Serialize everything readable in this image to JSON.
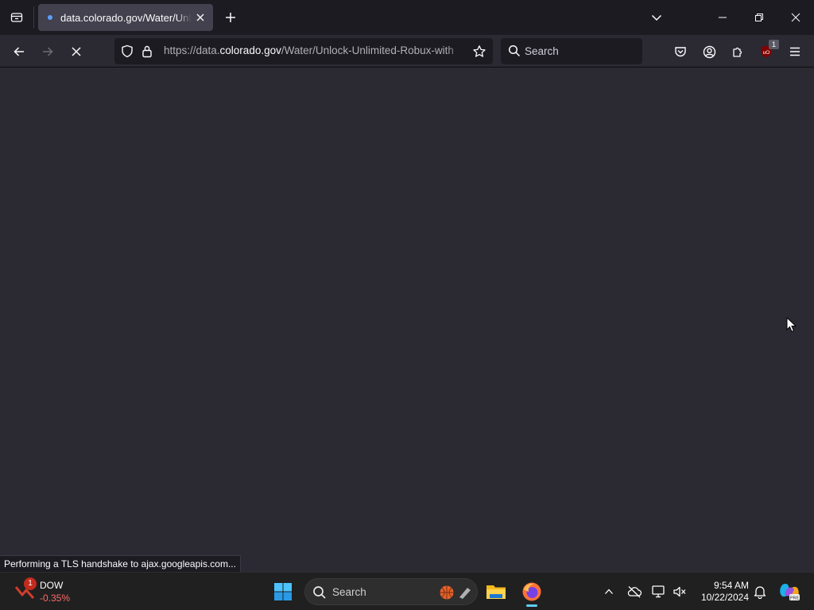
{
  "browser": {
    "tab": {
      "title": "data.colorado.gov/Water/Unlock-Unlimited-Robux-with"
    },
    "url": {
      "prefix": "https://data.",
      "host": "colorado.gov",
      "path": "/Water/Unlock-Unlimited-Robux-with"
    },
    "search": {
      "placeholder": "Search"
    },
    "extension_badge": "1",
    "status": "Performing a TLS handshake to ajax.googleapis.com..."
  },
  "taskbar": {
    "widget": {
      "name": "DOW",
      "change": "-0.35%",
      "badge": "1"
    },
    "search": {
      "placeholder": "Search"
    },
    "clock": {
      "time": "9:54 AM",
      "date": "10/22/2024"
    }
  },
  "colors": {
    "tabstrip": "#1c1b22",
    "toolbar": "#2b2a33",
    "content": "#2b2a33",
    "taskbar": "#202020",
    "accent": "#60cdff",
    "negative": "#ff6a6a"
  }
}
